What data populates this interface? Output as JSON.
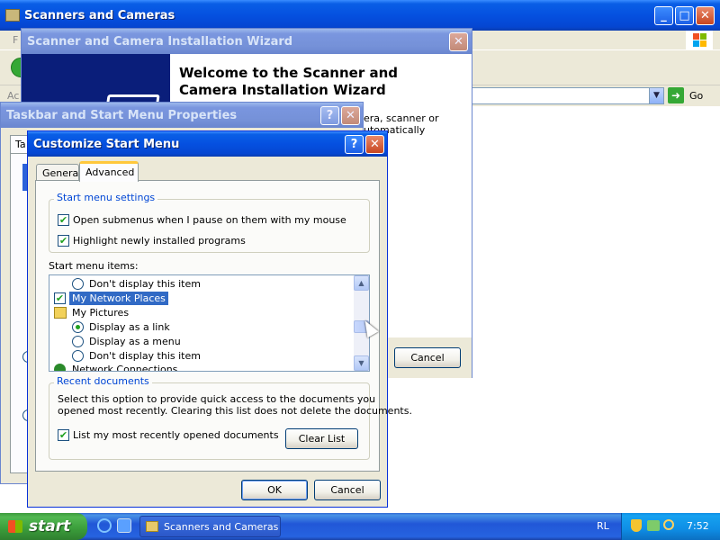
{
  "scanners_window": {
    "title": "Scanners and Cameras",
    "menu_fragment": "F",
    "address_fragment": "Ac",
    "go_label": "Go"
  },
  "wizard": {
    "title": "Scanner and Camera Installation Wizard",
    "heading": "Welcome to the Scanner and Camera Installation Wizard",
    "body_fragment_line1": "era, scanner or",
    "body_fragment_line2": "utomatically",
    "cancel_label": "Cancel"
  },
  "taskbar_props": {
    "title": "Taskbar and Start Menu Properties",
    "tab_fragment": "Ta"
  },
  "customize": {
    "title": "Customize Start Menu",
    "tabs": [
      {
        "label": "General",
        "active": false
      },
      {
        "label": "Advanced",
        "active": true
      }
    ],
    "settings_group": {
      "label": "Start menu settings",
      "options": [
        {
          "label": "Open submenus when I pause on them with my mouse",
          "checked": true
        },
        {
          "label": "Highlight newly installed programs",
          "checked": true
        }
      ]
    },
    "items_label": "Start menu items:",
    "items": {
      "r1": "Don't display this item",
      "my_network_places": "My Network Places",
      "my_pictures": "My Pictures",
      "r2": "Display as a link",
      "r3": "Display as a menu",
      "r4": "Don't display this item",
      "network_connections": "Network Connections"
    },
    "recent": {
      "label": "Recent documents",
      "description_line1": "Select this option to provide quick access to the documents you",
      "description_line2": "opened most recently.  Clearing this list does not delete the documents.",
      "list_label": "List my most recently opened documents",
      "list_checked": true,
      "clear_label": "Clear List"
    },
    "ok_label": "OK",
    "cancel_label": "Cancel"
  },
  "taskbar": {
    "start_label": "start",
    "task_label": "Scanners and Cameras",
    "lang": "RL",
    "clock": "7:52"
  },
  "colors": {
    "accent": "#0a5fe6",
    "selection": "#316ac5",
    "group_label": "#0046d5",
    "check_mark": "#21a121"
  }
}
